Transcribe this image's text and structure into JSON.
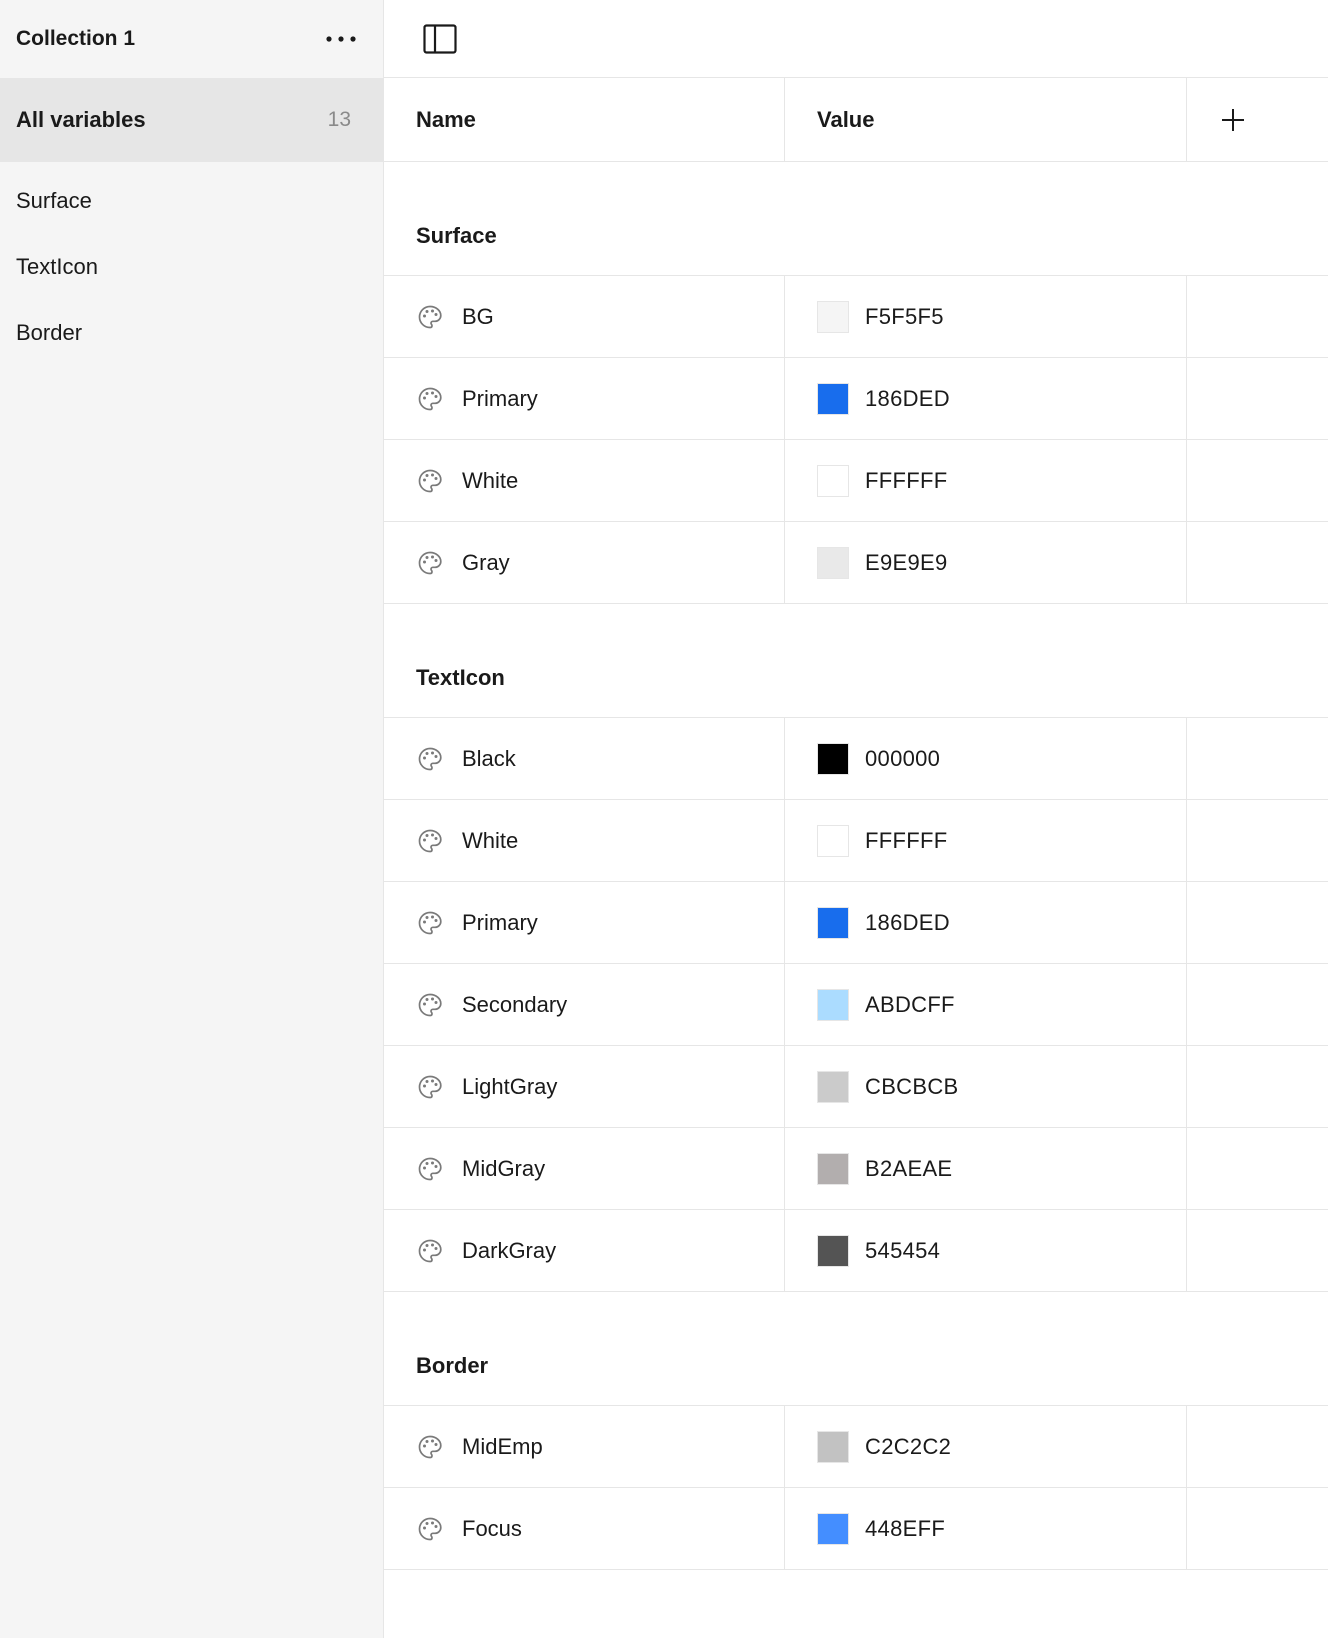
{
  "sidebar": {
    "collection_title": "Collection 1",
    "all_variables_label": "All variables",
    "all_variables_count": "13",
    "groups": [
      {
        "label": "Surface"
      },
      {
        "label": "TextIcon"
      },
      {
        "label": "Border"
      }
    ]
  },
  "table": {
    "headers": {
      "name": "Name",
      "value": "Value"
    },
    "groups": [
      {
        "title": "Surface",
        "rows": [
          {
            "name": "BG",
            "value": "F5F5F5",
            "color": "#F5F5F5"
          },
          {
            "name": "Primary",
            "value": "186DED",
            "color": "#186DED"
          },
          {
            "name": "White",
            "value": "FFFFFF",
            "color": "#FFFFFF"
          },
          {
            "name": "Gray",
            "value": "E9E9E9",
            "color": "#E9E9E9"
          }
        ]
      },
      {
        "title": "TextIcon",
        "rows": [
          {
            "name": "Black",
            "value": "000000",
            "color": "#000000"
          },
          {
            "name": "White",
            "value": "FFFFFF",
            "color": "#FFFFFF"
          },
          {
            "name": "Primary",
            "value": "186DED",
            "color": "#186DED"
          },
          {
            "name": "Secondary",
            "value": "ABDCFF",
            "color": "#ABDCFF"
          },
          {
            "name": "LightGray",
            "value": "CBCBCB",
            "color": "#CBCBCB"
          },
          {
            "name": "MidGray",
            "value": "B2AEAE",
            "color": "#B2AEAE"
          },
          {
            "name": "DarkGray",
            "value": "545454",
            "color": "#545454"
          }
        ]
      },
      {
        "title": "Border",
        "rows": [
          {
            "name": "MidEmp",
            "value": "C2C2C2",
            "color": "#C2C2C2"
          },
          {
            "name": "Focus",
            "value": "448EFF",
            "color": "#448EFF"
          }
        ]
      }
    ]
  },
  "icons": {
    "more": "more-horizontal-icon",
    "panel_toggle": "sidebar-panel-icon",
    "add": "plus-icon",
    "variable_type": "palette-icon"
  }
}
